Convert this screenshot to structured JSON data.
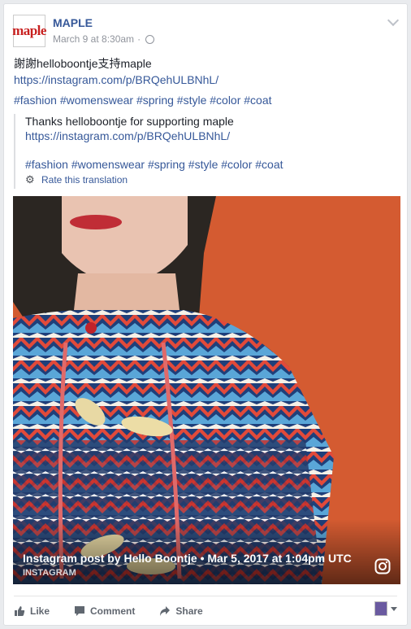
{
  "post": {
    "page_name": "MAPLE",
    "avatar_text": "maple",
    "timestamp": "March 9 at 8:30am",
    "separator": "·",
    "original_text": "謝謝helloboontje支持maple",
    "original_link": "https://instagram.com/p/BRQehULBNhL/",
    "original_tags": "#fashion #womenswear #spring #style #color #coat",
    "translation": {
      "text": "Thanks helloboontje for supporting maple",
      "link": "https://instagram.com/p/BRQehULBNhL/",
      "tags": "#fashion #womenswear #spring #style #color #coat",
      "rate_label": "Rate this translation"
    },
    "media": {
      "title": "Instagram post by Hello Boontje • Mar 5, 2017 at 1:04pm UTC",
      "source": "INSTAGRAM",
      "icon": "instagram-icon"
    }
  },
  "actions": {
    "like": "Like",
    "comment": "Comment",
    "share": "Share"
  },
  "colors": {
    "link": "#365899",
    "background": "#e9ebee",
    "orange_wall": "#d25a30"
  }
}
